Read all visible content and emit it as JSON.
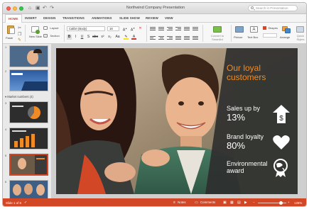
{
  "window": {
    "title": "Northwind Company Presentation",
    "search_placeholder": "Search in Presentation"
  },
  "ribbon_tabs": [
    "HOME",
    "INSERT",
    "DESIGN",
    "TRANSITIONS",
    "ANIMATIONS",
    "SLIDE SHOW",
    "REVIEW",
    "VIEW"
  ],
  "ribbon": {
    "paste": "Paste",
    "new_slide": "New Slide",
    "layout": "Layout",
    "section": "Section",
    "font_name": "Calibri (Body)",
    "font_size": "18",
    "convert_smartart": "Convert to SmartArt",
    "picture": "Picture",
    "text_box": "Text Box",
    "shapes": "Shapes",
    "arrange": "Arrange",
    "quick_styles": "Quick Styles"
  },
  "slides_pane": {
    "section_label": "Market numbers (4)",
    "thumbs": [
      {
        "num": "1"
      },
      {
        "num": "2"
      },
      {
        "num": "3"
      },
      {
        "num": "4"
      },
      {
        "num": "5"
      },
      {
        "num": "6"
      }
    ]
  },
  "slide": {
    "title": "Our loyal customers",
    "stats": [
      {
        "label": "Sales up by",
        "value": "13%",
        "icon": "dollar-arrow-icon"
      },
      {
        "label": "Brand loyalty",
        "value": "80%",
        "icon": "heart-icon"
      },
      {
        "label": "Environmental award",
        "value": "",
        "icon": "globe-award-icon"
      }
    ]
  },
  "status_bar": {
    "slide_position": "Slide 1 of 6",
    "notes": "Notes",
    "comments": "Comments",
    "zoom": "125%"
  },
  "colors": {
    "accent": "#d24726",
    "slide_title": "#f08a24"
  }
}
